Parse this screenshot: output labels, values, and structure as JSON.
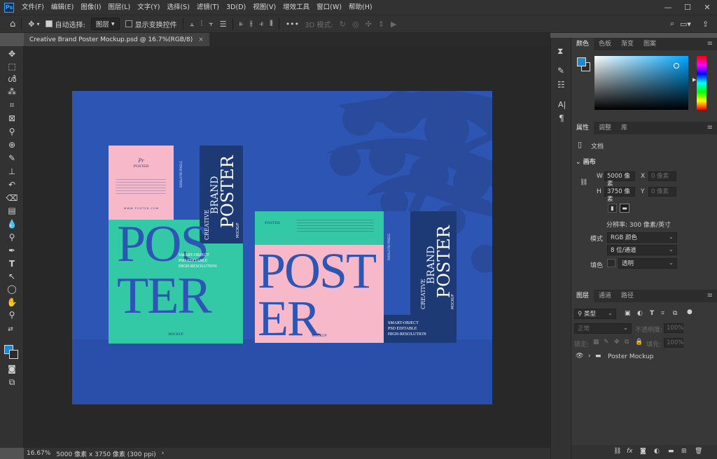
{
  "app": {
    "logo": "Ps",
    "menu": [
      "文件(F)",
      "编辑(E)",
      "图像(I)",
      "图层(L)",
      "文字(Y)",
      "选择(S)",
      "滤镜(T)",
      "3D(D)",
      "视图(V)",
      "增效工具",
      "窗口(W)",
      "帮助(H)"
    ]
  },
  "options": {
    "auto_select_label": "自动选择:",
    "auto_select_value": "图层",
    "show_transform_label": "显示变换控件",
    "mode_3d": "3D 模式:"
  },
  "document": {
    "tab_title": "Creative Brand Poster Mockup.psd @ 16.7%(RGB/8)",
    "close": "×"
  },
  "status": {
    "zoom": "16.67%",
    "info": "5000 像素 x 3750 像素 (300 ppi)",
    "arrow": "›"
  },
  "poster": {
    "brand_small": "POSTER",
    "brand_script": "Pr",
    "big1": "POS",
    "big2": "TER",
    "big3": "POST",
    "big4": "ER",
    "creative": "CREATIVE",
    "brand": "BRAND",
    "poster_vertical": "POSTER",
    "mockup": "MOCKUP",
    "features": [
      "SMART-OBJECT",
      "PSD EDITABLE",
      "HIGH-RESOLUTION"
    ],
    "footer": "MOCKUP",
    "url": "W W W . P O S T E R . C O M",
    "vert_small": "5000x3750 PIXELS"
  },
  "color_panel": {
    "tabs": [
      "颜色",
      "色板",
      "渐变",
      "图案"
    ],
    "fg": "#1a8ad4",
    "bg": "#2b2b2b"
  },
  "properties": {
    "tabs": [
      "属性",
      "调整",
      "库"
    ],
    "doc_label": "文档",
    "canvas_label": "画布",
    "w_label": "W",
    "w_value": "5000 像素",
    "h_label": "H",
    "h_value": "3750 像素",
    "x_label": "X",
    "x_value": "0 像素",
    "y_label": "Y",
    "y_value": "0 像素",
    "resolution": "分辨率: 300 像素/英寸",
    "mode_label": "模式",
    "mode_value": "RGB 颜色",
    "depth_value": "8 位/通道",
    "fill_label": "填色",
    "fill_value": "透明"
  },
  "layers": {
    "tabs": [
      "图层",
      "通道",
      "路径"
    ],
    "filter": "类型",
    "blend": "正常",
    "opacity_label": "不透明度:",
    "opacity_value": "100%",
    "lock_label": "锁定:",
    "fill_label": "填充:",
    "fill_value": "100%",
    "items": [
      {
        "name": "Poster Mockup"
      }
    ]
  },
  "colors": {
    "canvas": "#2d55b3",
    "teal": "#33c9a6",
    "pink": "#f7b9c9",
    "navy": "#1e3a74",
    "bluetype": "#2d55b3"
  }
}
